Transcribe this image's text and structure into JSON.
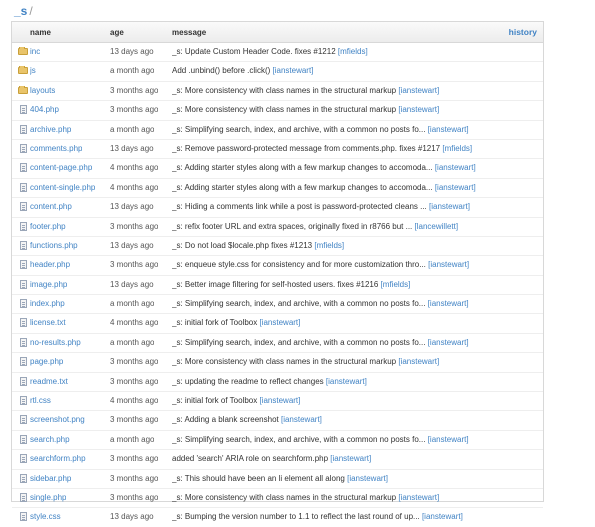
{
  "breadcrumb": {
    "root": "_s",
    "sep": "/"
  },
  "columns": {
    "name": "name",
    "age": "age",
    "message": "message",
    "history": "history"
  },
  "rows": [
    {
      "type": "folder",
      "name": "inc",
      "age": "13 days ago",
      "message": "_s: Update Custom Header Code. fixes #1212",
      "author": "[mfields]"
    },
    {
      "type": "folder",
      "name": "js",
      "age": "a month ago",
      "message": "Add .unbind() before .click()",
      "author": "[ianstewart]"
    },
    {
      "type": "folder",
      "name": "layouts",
      "age": "3 months ago",
      "message": "_s: More consistency with class names in the structural markup",
      "author": "[ianstewart]"
    },
    {
      "type": "file",
      "name": "404.php",
      "age": "3 months ago",
      "message": "_s: More consistency with class names in the structural markup",
      "author": "[ianstewart]"
    },
    {
      "type": "file",
      "name": "archive.php",
      "age": "a month ago",
      "message": "_s: Simplifying search, index, and archive, with a common no posts fo...",
      "author": "[ianstewart]"
    },
    {
      "type": "file",
      "name": "comments.php",
      "age": "13 days ago",
      "message": "_s: Remove password-protected message from comments.php. fixes #1217",
      "author": "[mfields]"
    },
    {
      "type": "file",
      "name": "content-page.php",
      "age": "4 months ago",
      "message": "_s: Adding starter styles along with a few markup changes to accomoda...",
      "author": "[ianstewart]"
    },
    {
      "type": "file",
      "name": "content-single.php",
      "age": "4 months ago",
      "message": "_s: Adding starter styles along with a few markup changes to accomoda...",
      "author": "[ianstewart]"
    },
    {
      "type": "file",
      "name": "content.php",
      "age": "13 days ago",
      "message": "_s: Hiding a comments link while a post is password-protected cleans ...",
      "author": "[ianstewart]"
    },
    {
      "type": "file",
      "name": "footer.php",
      "age": "3 months ago",
      "message": "_s: refix footer URL and extra spaces, originally fixed in r8766 but ...",
      "author": "[lancewillett]"
    },
    {
      "type": "file",
      "name": "functions.php",
      "age": "13 days ago",
      "message": "_s: Do not load $locale.php fixes #1213",
      "author": "[mfields]"
    },
    {
      "type": "file",
      "name": "header.php",
      "age": "3 months ago",
      "message": "_s: enqueue style.css for consistency and for more customization thro...",
      "author": "[ianstewart]"
    },
    {
      "type": "file",
      "name": "image.php",
      "age": "13 days ago",
      "message": "_s: Better image filtering for self-hosted users. fixes #1216",
      "author": "[mfields]"
    },
    {
      "type": "file",
      "name": "index.php",
      "age": "a month ago",
      "message": "_s: Simplifying search, index, and archive, with a common no posts fo...",
      "author": "[ianstewart]"
    },
    {
      "type": "file",
      "name": "license.txt",
      "age": "4 months ago",
      "message": "_s: initial fork of Toolbox",
      "author": "[ianstewart]"
    },
    {
      "type": "file",
      "name": "no-results.php",
      "age": "a month ago",
      "message": "_s: Simplifying search, index, and archive, with a common no posts fo...",
      "author": "[ianstewart]"
    },
    {
      "type": "file",
      "name": "page.php",
      "age": "3 months ago",
      "message": "_s: More consistency with class names in the structural markup",
      "author": "[ianstewart]"
    },
    {
      "type": "file",
      "name": "readme.txt",
      "age": "3 months ago",
      "message": "_s: updating the readme to reflect changes",
      "author": "[ianstewart]"
    },
    {
      "type": "file",
      "name": "rtl.css",
      "age": "4 months ago",
      "message": "_s: initial fork of Toolbox",
      "author": "[ianstewart]"
    },
    {
      "type": "file",
      "name": "screenshot.png",
      "age": "3 months ago",
      "message": "_s: Adding a blank screenshot",
      "author": "[ianstewart]"
    },
    {
      "type": "file",
      "name": "search.php",
      "age": "a month ago",
      "message": "_s: Simplifying search, index, and archive, with a common no posts fo...",
      "author": "[ianstewart]"
    },
    {
      "type": "file",
      "name": "searchform.php",
      "age": "3 months ago",
      "message": "added 'search' ARIA role on searchform.php",
      "author": "[ianstewart]"
    },
    {
      "type": "file",
      "name": "sidebar.php",
      "age": "3 months ago",
      "message": "_s: This should have been an li element all along",
      "author": "[ianstewart]"
    },
    {
      "type": "file",
      "name": "single.php",
      "age": "3 months ago",
      "message": "_s: More consistency with class names in the structural markup",
      "author": "[ianstewart]"
    },
    {
      "type": "file",
      "name": "style.css",
      "age": "13 days ago",
      "message": "_s: Bumping the version number to 1.1 to reflect the last round of up...",
      "author": "[ianstewart]"
    }
  ]
}
